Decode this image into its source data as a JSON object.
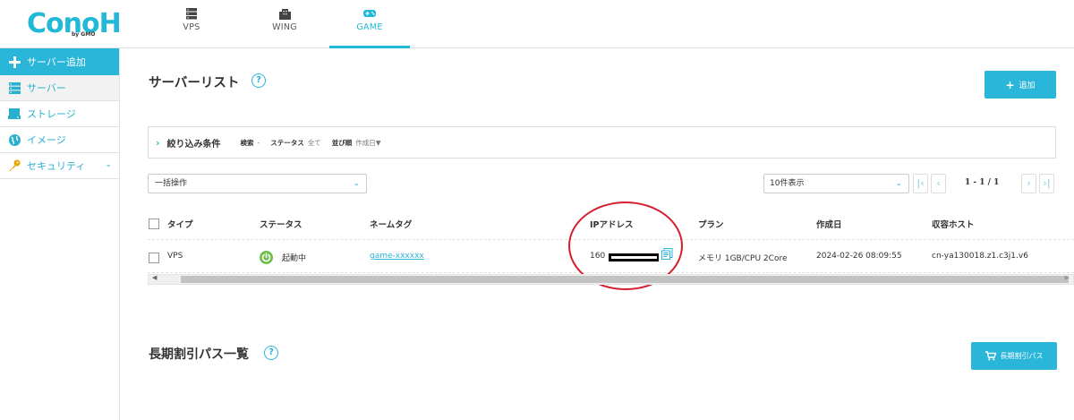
{
  "brand": {
    "logo_text": "ConoHa",
    "logo_sub": "by GMO"
  },
  "topnav": [
    {
      "label": "VPS",
      "icon": "server-icon"
    },
    {
      "label": "WING",
      "icon": "building-icon"
    },
    {
      "label": "GAME",
      "icon": "gamepad-icon",
      "active": true
    }
  ],
  "sidebar": {
    "items": [
      {
        "label": "サーバー追加",
        "icon": "plus-icon"
      },
      {
        "label": "サーバー",
        "icon": "server-icon"
      },
      {
        "label": "ストレージ",
        "icon": "storage-icon"
      },
      {
        "label": "イメージ",
        "icon": "globe-icon"
      },
      {
        "label": "セキュリティ",
        "icon": "key-icon"
      }
    ]
  },
  "server_list": {
    "title": "サーバーリスト",
    "help": "?",
    "add_button": "追加",
    "filter": {
      "title": "絞り込み条件",
      "search_key": "検索",
      "search_value": "-",
      "status_key": "ステータス",
      "status_value": "全て",
      "sort_key": "並び順",
      "sort_value": "作成日▼"
    },
    "bulk_action": "一括操作",
    "per_page": "10件表示",
    "pagination": "1 - 1 / 1",
    "columns": [
      "タイプ",
      "ステータス",
      "ネームタグ",
      "IPアドレス",
      "プラン",
      "作成日",
      "収容ホスト"
    ],
    "rows": [
      {
        "type": "VPS",
        "status": "起動中",
        "name_tag": "game-xxxxxx",
        "ip_prefix": "160",
        "plan": "メモリ 1GB/CPU 2Core",
        "created": "2024-02-26 08:09:55",
        "host": "cn-ya130018.z1.c3j1.v6"
      }
    ]
  },
  "long_term": {
    "title": "長期割引パス一覧",
    "help": "?",
    "button": "長期割引パス"
  },
  "colors": {
    "accent": "#29b6d8",
    "status_green": "#6cc04a",
    "annotation_red": "#d51e2e"
  }
}
